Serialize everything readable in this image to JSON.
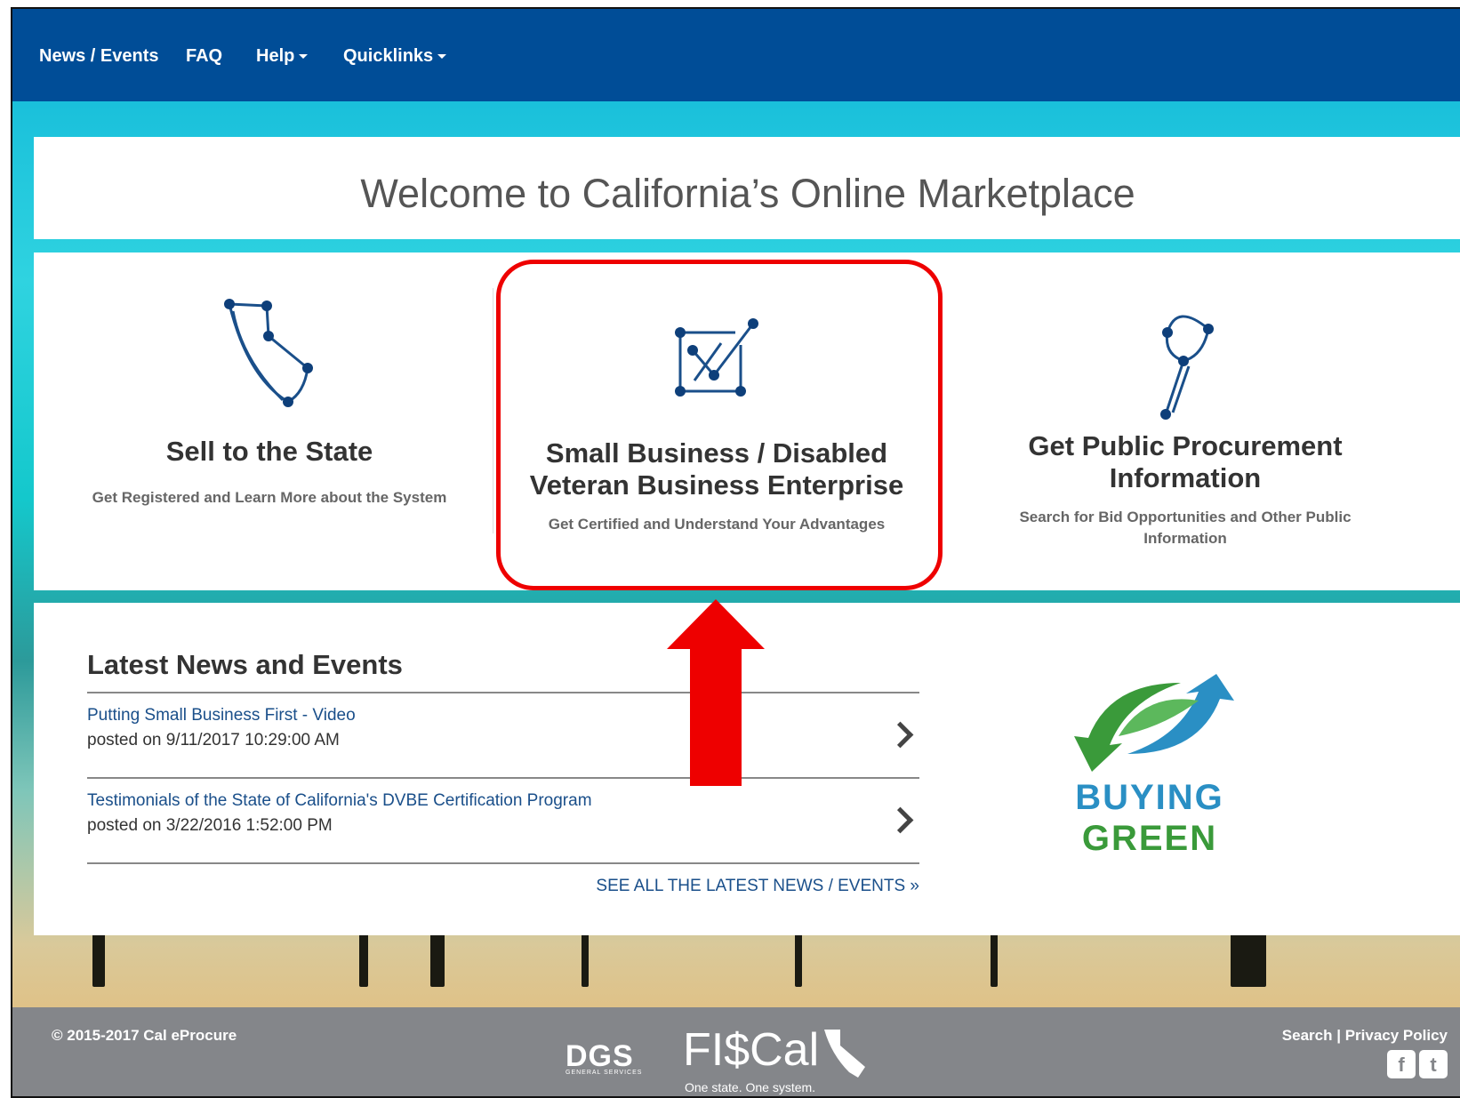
{
  "nav": {
    "items": [
      {
        "label": "News / Events"
      },
      {
        "label": "FAQ"
      },
      {
        "label": "Help"
      },
      {
        "label": "Quicklinks"
      }
    ]
  },
  "welcome": {
    "title": "Welcome to California’s Online Marketplace"
  },
  "cards": [
    {
      "title": "Sell to the State",
      "desc": "Get Registered and Learn More about the System",
      "icon": "california-constellation-icon"
    },
    {
      "title_line1": "Small Business / Disabled",
      "title_line2": "Veteran Business Enterprise",
      "desc": "Get Certified and Understand Your Advantages",
      "icon": "checkbox-constellation-icon"
    },
    {
      "title_line1": "Get Public Procurement",
      "title_line2": "Information",
      "desc_line1": "Search for Bid Opportunities and Other Public",
      "desc_line2": "Information",
      "icon": "magnifier-constellation-icon"
    }
  ],
  "news": {
    "heading": "Latest News and Events",
    "items": [
      {
        "title": "Putting Small Business First - Video",
        "posted": "posted on 9/11/2017 10:29:00 AM"
      },
      {
        "title": "Testimonials of the State of California's DVBE Certification Program",
        "posted": "posted on 3/22/2016 1:52:00 PM"
      }
    ],
    "see_all": "SEE ALL THE LATEST NEWS / EVENTS »"
  },
  "buying_green": {
    "line1": "BUYING",
    "line2": "GREEN",
    "color_green": "#3a9a3a",
    "color_blue": "#2a8fc4"
  },
  "annotation": {
    "highlight_color": "#ee0000"
  },
  "footer": {
    "copyright": "© 2015-2017 Cal eProcure",
    "links": "Search | Privacy Policy",
    "dgs": "DGS",
    "dgs_sub": "GENERAL SERVICES",
    "fiscal": "FI$Cal",
    "fiscal_tagline": "One state. One system.",
    "social": [
      "facebook-icon",
      "twitter-icon"
    ]
  },
  "colors": {
    "nav_bg": "#004d97",
    "link": "#1a4f8a",
    "footer_bg": "#84868a"
  }
}
